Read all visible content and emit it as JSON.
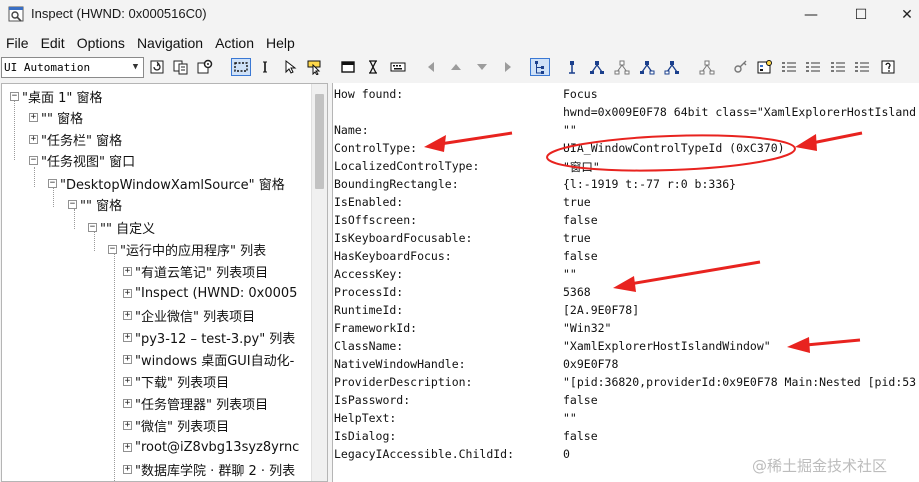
{
  "window": {
    "title": "Inspect  (HWND: 0x000516C0)",
    "controls": {
      "minimize": "—",
      "maximize": "☐",
      "close": "✕"
    }
  },
  "menu": [
    "File",
    "Edit",
    "Options",
    "Navigation",
    "Action",
    "Help"
  ],
  "toolbar": {
    "mode_select": "UI Automation",
    "icons": [
      "refresh-icon",
      "copy-icon",
      "settings-icon",
      "highlight-rect-icon",
      "caret-icon",
      "pointer-icon",
      "focus-tracking-icon",
      "window-icon",
      "hourglass-icon",
      "keyboard-icon",
      "nav-left-icon",
      "nav-up-icon",
      "nav-down-icon",
      "nav-right-icon",
      "tree-view-icon",
      "tree-node-icon",
      "tree-parent-icon",
      "tree-first-child-icon",
      "tree-prev-icon",
      "tree-next-icon",
      "tree-last-icon",
      "key-icon",
      "properties-icon",
      "list-icon",
      "help-icon"
    ]
  },
  "tree": [
    {
      "label": "\"桌面 1\" 窗格",
      "expander": "−"
    },
    {
      "label": "\"\" 窗格",
      "expander": "+"
    },
    {
      "label": "\"任务栏\" 窗格",
      "expander": "+"
    },
    {
      "label": "\"任务视图\" 窗口",
      "expander": "−"
    },
    {
      "label": "\"DesktopWindowXamlSource\" 窗格",
      "expander": "−"
    },
    {
      "label": "\"\" 窗格",
      "expander": "−"
    },
    {
      "label": "\"\" 自定义",
      "expander": "−"
    },
    {
      "label": "\"运行中的应用程序\" 列表",
      "expander": "−"
    },
    {
      "label": "\"有道云笔记\" 列表项目",
      "expander": "+"
    },
    {
      "label": "\"Inspect  (HWND: 0x0005",
      "expander": "+"
    },
    {
      "label": "\"企业微信\" 列表项目",
      "expander": "+"
    },
    {
      "label": "\"py3-12 – test-3.py\" 列表",
      "expander": "+"
    },
    {
      "label": "\"windows 桌面GUI自动化-",
      "expander": "+"
    },
    {
      "label": "\"下载\" 列表项目",
      "expander": "+"
    },
    {
      "label": "\"任务管理器\" 列表项目",
      "expander": "+"
    },
    {
      "label": "\"微信\" 列表项目",
      "expander": "+"
    },
    {
      "label": "\"root@iZ8vbg13syz8yrnc",
      "expander": "+"
    },
    {
      "label": "\"数据库学院 · 群聊 2 · 列表",
      "expander": "+"
    }
  ],
  "properties": [
    {
      "name": "How found:",
      "value": "Focus"
    },
    {
      "name": "",
      "value": "hwnd=0x009E0F78 64bit class=\"XamlExplorerHostIsland"
    },
    {
      "name": "Name:",
      "value": "\"\""
    },
    {
      "name": "ControlType:",
      "value": "UIA_WindowControlTypeId (0xC370)"
    },
    {
      "name": "LocalizedControlType:",
      "value": "\"窗口\""
    },
    {
      "name": "BoundingRectangle:",
      "value": "{l:-1919 t:-77 r:0 b:336}"
    },
    {
      "name": "IsEnabled:",
      "value": "true"
    },
    {
      "name": "IsOffscreen:",
      "value": "false"
    },
    {
      "name": "IsKeyboardFocusable:",
      "value": "true"
    },
    {
      "name": "HasKeyboardFocus:",
      "value": "false"
    },
    {
      "name": "AccessKey:",
      "value": "\"\""
    },
    {
      "name": "ProcessId:",
      "value": "5368"
    },
    {
      "name": "RuntimeId:",
      "value": "[2A.9E0F78]"
    },
    {
      "name": "FrameworkId:",
      "value": "\"Win32\""
    },
    {
      "name": "ClassName:",
      "value": "\"XamlExplorerHostIslandWindow\""
    },
    {
      "name": "NativeWindowHandle:",
      "value": "0x9E0F78"
    },
    {
      "name": "ProviderDescription:",
      "value": "\"[pid:36820,providerId:0x9E0F78 Main:Nested [pid:53"
    },
    {
      "name": "IsPassword:",
      "value": "false"
    },
    {
      "name": "HelpText:",
      "value": "\"\""
    },
    {
      "name": "IsDialog:",
      "value": "false"
    },
    {
      "name": "LegacyIAccessible.ChildId:",
      "value": "0"
    }
  ],
  "watermark": "@稀土掘金技术社区",
  "colors": {
    "annotation_red": "#e8231f",
    "selected_blue": "#3a78d4"
  }
}
